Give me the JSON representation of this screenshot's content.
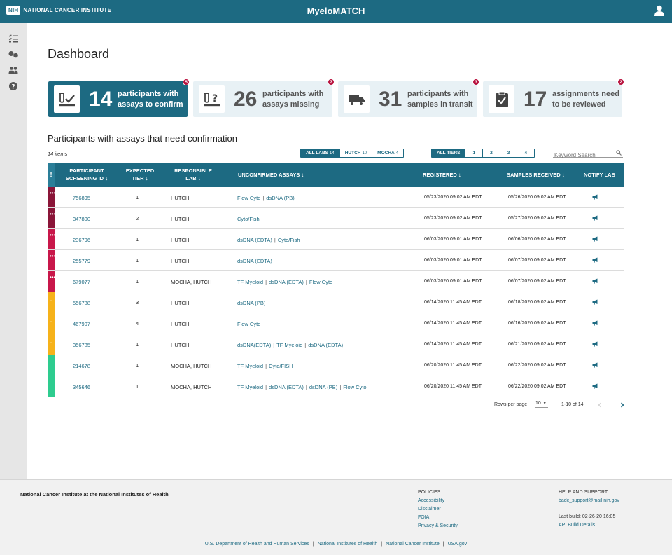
{
  "header": {
    "nih_badge": "NIH",
    "brand": "NATIONAL CANCER INSTITUTE",
    "app_title": "MyeloMATCH"
  },
  "page": {
    "title": "Dashboard"
  },
  "cards": [
    {
      "count": "14",
      "label": "participants with assays to confirm",
      "badge": "5",
      "active": true
    },
    {
      "count": "26",
      "label": "participants with assays missing",
      "badge": "7",
      "active": false
    },
    {
      "count": "31",
      "label": "participants with samples in transit",
      "badge": "3",
      "active": false
    },
    {
      "count": "17",
      "label": "assignments need to be reviewed",
      "badge": "2",
      "active": false
    }
  ],
  "section": {
    "title": "Participants with assays that need confirmation",
    "item_count": "14 items"
  },
  "lab_filters": [
    {
      "label": "ALL LABS",
      "num": "14",
      "selected": true
    },
    {
      "label": "HUTCH",
      "num": "10",
      "selected": false
    },
    {
      "label": "MOCHA",
      "num": "4",
      "selected": false
    }
  ],
  "tier_filters": [
    {
      "label": "ALL TIERS",
      "selected": true
    },
    {
      "label": "1",
      "selected": false
    },
    {
      "label": "2",
      "selected": false
    },
    {
      "label": "3",
      "selected": false
    },
    {
      "label": "4",
      "selected": false
    }
  ],
  "search": {
    "placeholder": "Keyword Search"
  },
  "table": {
    "headers": {
      "flag": "!",
      "id": "PARTICIPANT SCREENING ID",
      "tier": "EXPECTED TIER",
      "lab": "RESPONSIBLE LAB",
      "assays": "UNCONFIRMED ASSAYS",
      "registered": "REGISTERED",
      "received": "SAMPLES RECEIVED",
      "notify": "NOTIFY LAB"
    },
    "colors": {
      "dark_red": "#8a1538",
      "red": "#c8174a",
      "yellow": "#f6b21a",
      "green": "#2ecc8f"
    },
    "rows": [
      {
        "flag": "dark_red",
        "id": "756895",
        "tier": "1",
        "lab": "HUTCH",
        "assays": [
          "Flow Cyto",
          "dsDNA (PB)"
        ],
        "registered": "05/23/2020  09:02 AM EDT",
        "received": "05/26/2020  09:02 AM EDT"
      },
      {
        "flag": "dark_red",
        "id": "347800",
        "tier": "2",
        "lab": "HUTCH",
        "assays": [
          "Cyto/Fish"
        ],
        "registered": "05/23/2020  09:02 AM EDT",
        "received": "05/27/2020  09:02 AM EDT"
      },
      {
        "flag": "red",
        "id": "236796",
        "tier": "1",
        "lab": "HUTCH",
        "assays": [
          "dsDNA (EDTA)",
          "Cyto/Fish"
        ],
        "registered": "06/03/2020  09:01 AM EDT",
        "received": "06/06/2020  09:02 AM EDT"
      },
      {
        "flag": "red",
        "id": "255779",
        "tier": "1",
        "lab": "HUTCH",
        "assays": [
          "dsDNA (EDTA)"
        ],
        "registered": "06/03/2020  09:01 AM EDT",
        "received": "06/07/2020  09:02 AM EDT"
      },
      {
        "flag": "red",
        "id": "679077",
        "tier": "1",
        "lab": "MOCHA, HUTCH",
        "assays": [
          "TF Myeloid",
          "dsDNA (EDTA)",
          "Flow Cyto"
        ],
        "registered": "06/03/2020  09:01 AM EDT",
        "received": "06/07/2020  09:02 AM EDT"
      },
      {
        "flag": "yellow",
        "id": "556788",
        "tier": "3",
        "lab": "HUTCH",
        "assays": [
          "dsDNA (PB)"
        ],
        "registered": "06/14/2020  11:45 AM EDT",
        "received": "06/18/2020  09:02 AM EDT"
      },
      {
        "flag": "yellow",
        "id": "467907",
        "tier": "4",
        "lab": "HUTCH",
        "assays": [
          "Flow Cyto"
        ],
        "registered": "06/14/2020  11:45 AM EDT",
        "received": "06/16/2020  09:02 AM EDT"
      },
      {
        "flag": "yellow",
        "id": "356785",
        "tier": "1",
        "lab": "HUTCH",
        "assays": [
          "dsDNA(EDTA)",
          "TF Myeloid",
          "dsDNA (EDTA)"
        ],
        "registered": "06/14/2020  11:45 AM EDT",
        "received": "06/21/2020  09:02 AM EDT"
      },
      {
        "flag": "green",
        "id": "214678",
        "tier": "1",
        "lab": "MOCHA, HUTCH",
        "assays": [
          "TF Myeloid",
          "Cyto/FISH"
        ],
        "registered": "06/20/2020  11:45 AM EDT",
        "received": "06/22/2020  09:02 AM EDT"
      },
      {
        "flag": "green",
        "id": "345646",
        "tier": "1",
        "lab": "MOCHA, HUTCH",
        "assays": [
          "TF Myeloid",
          "dsDNA (EDTA)",
          "dsDNA (PB)",
          "Flow Cyto"
        ],
        "registered": "06/20/2020  11:45 AM EDT",
        "received": "06/22/2020  09:02 AM EDT"
      }
    ]
  },
  "pagination": {
    "rows_label": "Rows per page",
    "rows_value": "10",
    "range": "1-10 of 14"
  },
  "footer": {
    "org": "National Cancer Institute at the National Institutes of Health",
    "policies_title": "POLICIES",
    "policies": [
      "Accessibility",
      "Disclaimer",
      "FOIA",
      "Privacy & Security"
    ],
    "help_title": "HELP AND SUPPORT",
    "help_email": "badc_support@mail.nih.gov",
    "last_build": "Last build: 02-26-20 16:05",
    "api_link": "API Build Details",
    "bottom_links": [
      "U.S. Department of Health and Human Services",
      "National Institutes of Health",
      "National Cancer Institute",
      "USA.gov"
    ]
  }
}
